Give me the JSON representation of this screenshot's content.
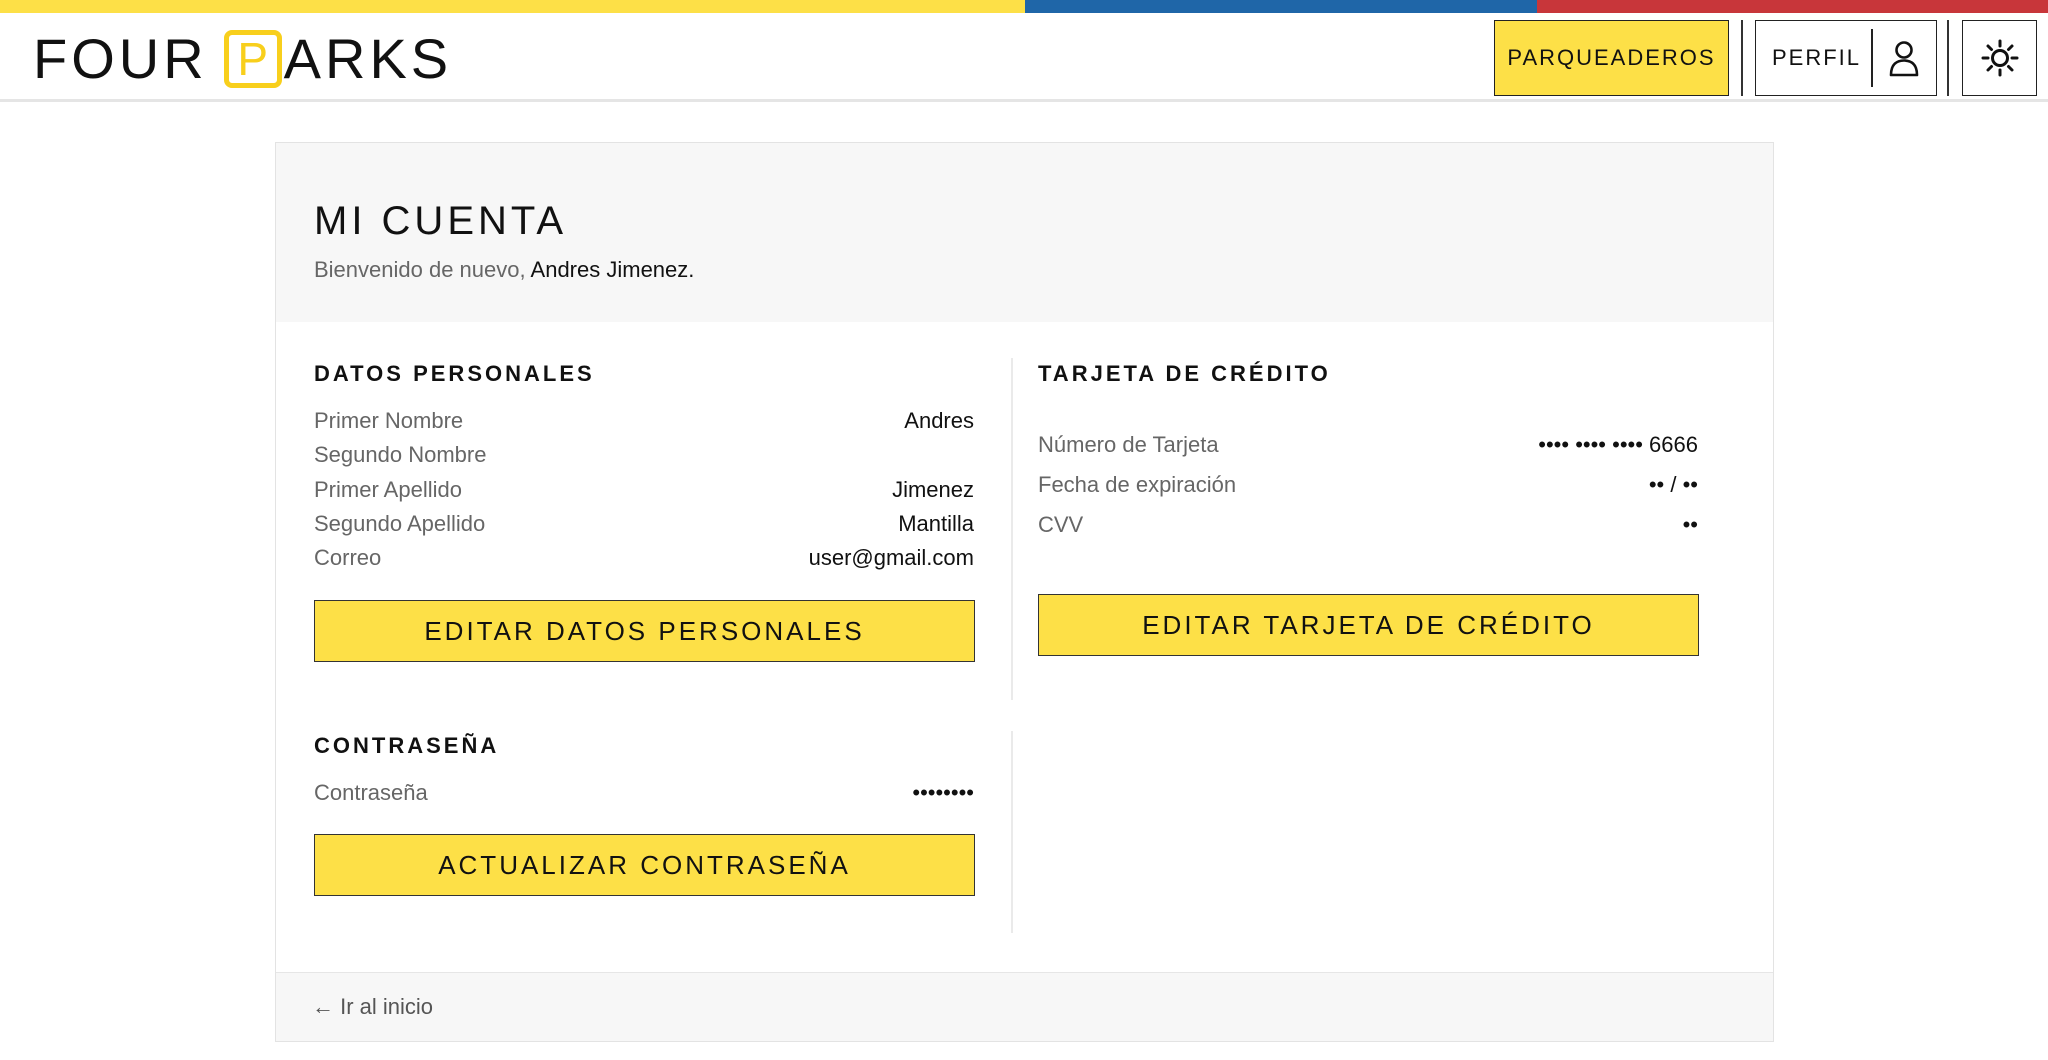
{
  "header": {
    "logo_left": "FOUR",
    "logo_p": "P",
    "logo_right": "ARKS",
    "parqueaderos_label": "PARQUEADEROS",
    "perfil_label": "PERFIL",
    "flag_colors": [
      "#fde047",
      "#1f66a8",
      "#c8363a"
    ],
    "icons": [
      "user-icon",
      "sun-icon"
    ]
  },
  "account": {
    "title": "MI CUENTA",
    "welcome_prefix": "Bienvenido de nuevo,",
    "welcome_name": "Andres Jimenez."
  },
  "personal": {
    "title": "DATOS PERSONALES",
    "rows": [
      {
        "label": "Primer Nombre",
        "value": "Andres"
      },
      {
        "label": "Segundo Nombre",
        "value": ""
      },
      {
        "label": "Primer Apellido",
        "value": "Jimenez"
      },
      {
        "label": "Segundo Apellido",
        "value": "Mantilla"
      },
      {
        "label": "Correo",
        "value": "user@gmail.com"
      }
    ],
    "button_label": "EDITAR DATOS PERSONALES"
  },
  "card": {
    "title": "TARJETA DE CRÉDITO",
    "rows": [
      {
        "label": "Número de Tarjeta",
        "value": "•••• •••• •••• 6666"
      },
      {
        "label": "Fecha de expiración",
        "value": "•• / ••"
      },
      {
        "label": "CVV",
        "value": "••"
      }
    ],
    "button_label": "EDITAR TARJETA DE CRÉDITO"
  },
  "password": {
    "title": "CONTRASEÑA",
    "label": "Contraseña",
    "value": "••••••••",
    "button_label": "ACTUALIZAR CONTRASEÑA"
  },
  "footer": {
    "back_label": "← Ir al inicio"
  },
  "accent_color": "#fde047"
}
